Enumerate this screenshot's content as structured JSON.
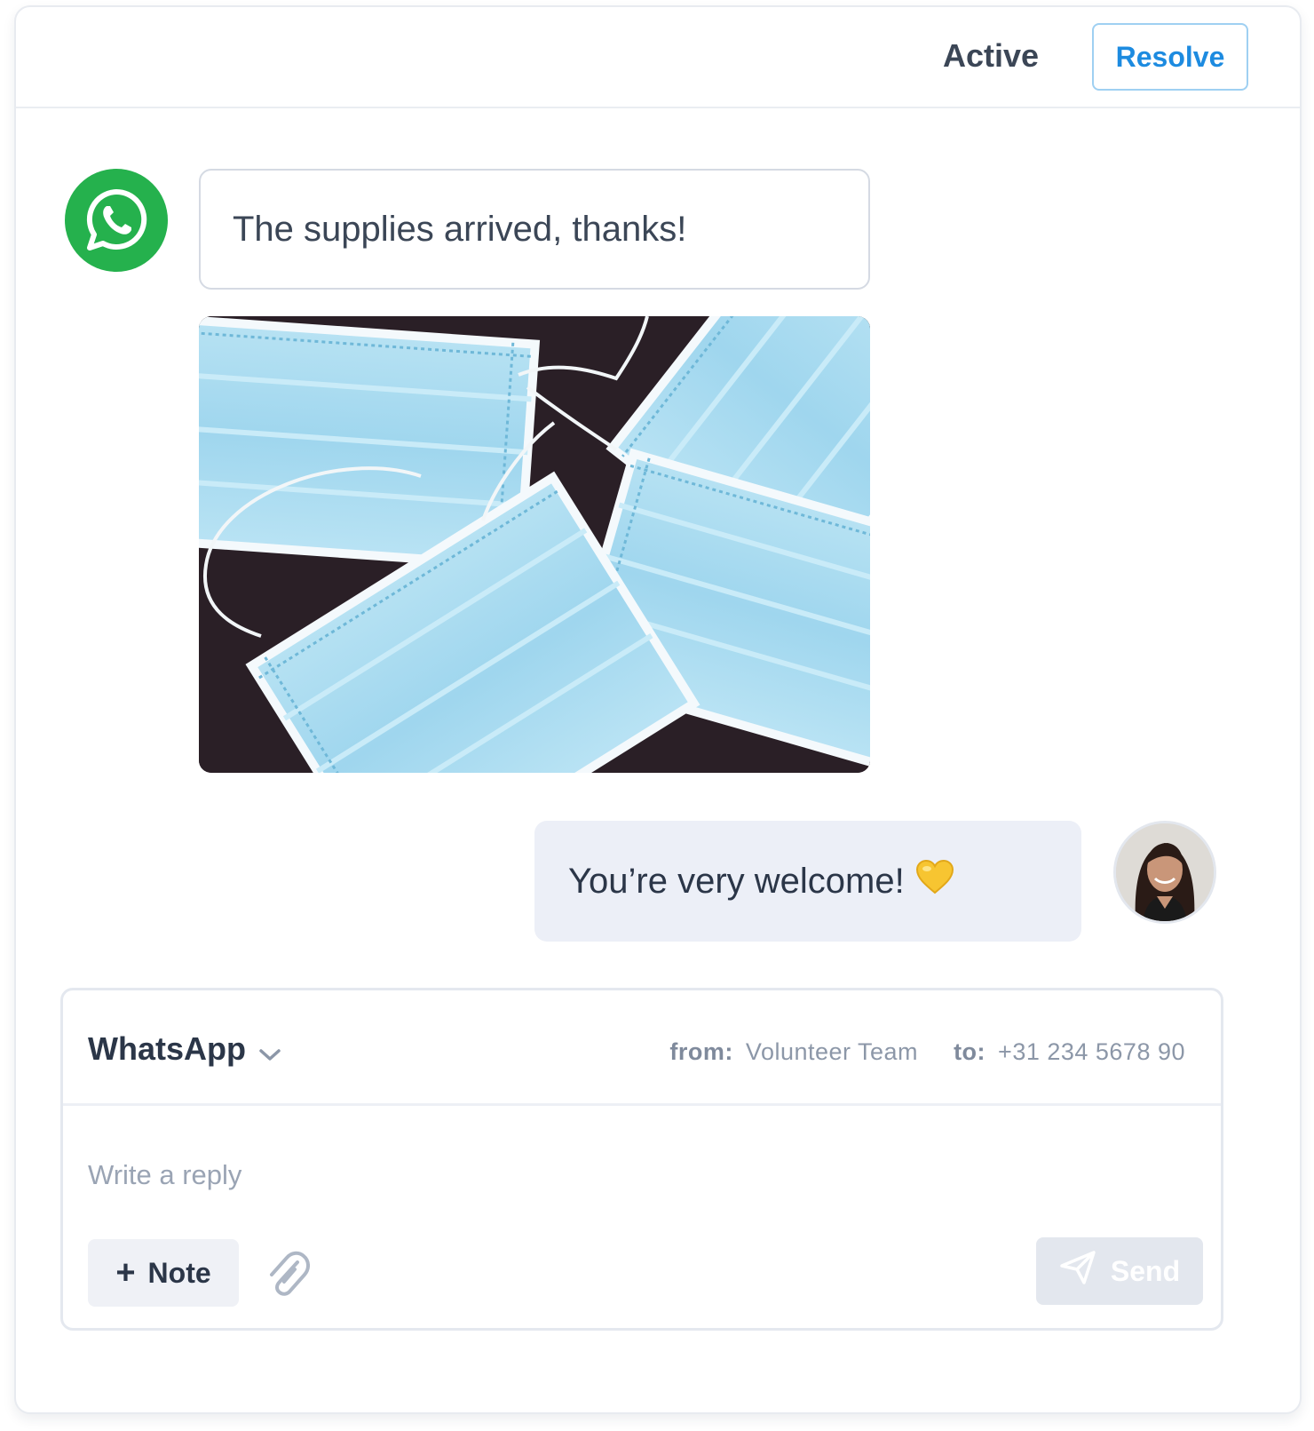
{
  "header": {
    "status": "Active",
    "resolve_label": "Resolve"
  },
  "conversation": {
    "incoming": {
      "channel_icon": "whatsapp-icon",
      "text": "The supplies arrived, thanks!",
      "image_icon": "face-masks-photo"
    },
    "outgoing": {
      "text": "You’re very welcome!",
      "emoji": "yellow-heart-icon"
    }
  },
  "composer": {
    "channel": "WhatsApp",
    "from_label": "from:",
    "from_value": "Volunteer Team",
    "to_label": "to:",
    "to_value": "+31 234 5678 90",
    "placeholder": "Write a reply",
    "note_label": "Note",
    "send_label": "Send"
  },
  "colors": {
    "accent": "#1d8be0",
    "whatsapp": "#25b14d",
    "outgoing_bubble": "#eceff7"
  }
}
